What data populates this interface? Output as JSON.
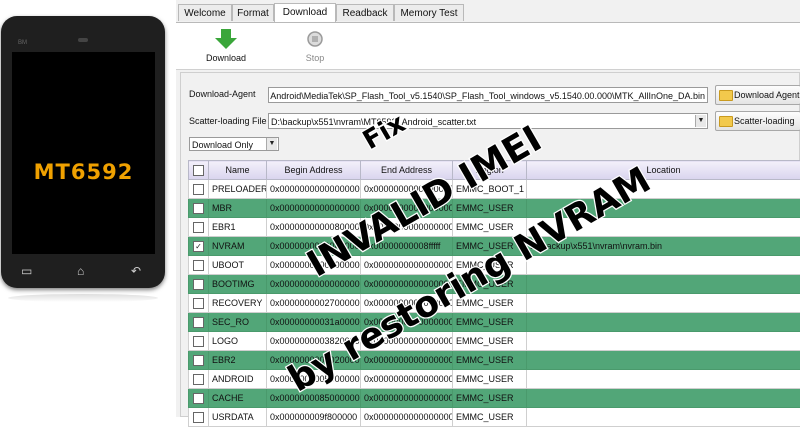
{
  "phone": {
    "brand": "BM",
    "model": "MT6592",
    "buttons": [
      "▭",
      "⌂",
      "↶"
    ]
  },
  "tabs": [
    {
      "label": "Welcome"
    },
    {
      "label": "Format"
    },
    {
      "label": "Download",
      "active": true
    },
    {
      "label": "Readback"
    },
    {
      "label": "Memory Test"
    }
  ],
  "toolbar": {
    "download_label": "Download",
    "stop_label": "Stop",
    "download_icon": "down-arrow-icon",
    "stop_icon": "stop-icon"
  },
  "form": {
    "da_label": "Download-Agent",
    "da_value": "Android\\MediaTek\\SP_Flash_Tool_v5.1540\\SP_Flash_Tool_windows_v5.1540.00.000\\MTK_AllInOne_DA.bin",
    "da_button": "Download Agent",
    "scatter_label": "Scatter-loading File",
    "scatter_value": "D:\\backup\\x551\\nvram\\MT6592_Android_scatter.txt",
    "scatter_button": "Scatter-loading",
    "mode_value": "Download Only"
  },
  "table": {
    "columns": [
      "",
      "Name",
      "Begin Address",
      "End Address",
      "Region",
      "Location"
    ],
    "rows": [
      {
        "checked": false,
        "name": "PRELOADER",
        "begin": "0x0000000000000000",
        "end": "0x0000000000000000",
        "region": "EMMC_BOOT_1",
        "location": ""
      },
      {
        "checked": false,
        "name": "MBR",
        "begin": "0x0000000000000000",
        "end": "0x0000000000000000",
        "region": "EMMC_USER",
        "location": ""
      },
      {
        "checked": false,
        "name": "EBR1",
        "begin": "0x0000000000080000",
        "end": "0x0000000000000000",
        "region": "EMMC_USER",
        "location": ""
      },
      {
        "checked": true,
        "name": "NVRAM",
        "begin": "0x0000000000040000",
        "end": "0x00000000008fffff",
        "region": "EMMC_USER",
        "location": "D:\\backup\\x551\\nvram\\nvram.bin"
      },
      {
        "checked": false,
        "name": "UBOOT",
        "begin": "0x0000000000000000",
        "end": "0x0000000000000000",
        "region": "EMMC_USER",
        "location": ""
      },
      {
        "checked": false,
        "name": "BOOTIMG",
        "begin": "0x0000000000000000",
        "end": "0x0000000000000000",
        "region": "EMMC_USER",
        "location": ""
      },
      {
        "checked": false,
        "name": "RECOVERY",
        "begin": "0x0000000002700000",
        "end": "0x0000000000000000",
        "region": "EMMC_USER",
        "location": ""
      },
      {
        "checked": false,
        "name": "SEC_RO",
        "begin": "0x00000000031a0000",
        "end": "0x0000000000000000",
        "region": "EMMC_USER",
        "location": ""
      },
      {
        "checked": false,
        "name": "LOGO",
        "begin": "0x0000000003820000",
        "end": "0x0000000000000000",
        "region": "EMMC_USER",
        "location": ""
      },
      {
        "checked": false,
        "name": "EBR2",
        "begin": "0x0000000004020000",
        "end": "0x0000000000000000",
        "region": "EMMC_USER",
        "location": ""
      },
      {
        "checked": false,
        "name": "ANDROID",
        "begin": "0x0000000005000000",
        "end": "0x0000000000000000",
        "region": "EMMC_USER",
        "location": ""
      },
      {
        "checked": false,
        "name": "CACHE",
        "begin": "0x0000000085000000",
        "end": "0x0000000000000000",
        "region": "EMMC_USER",
        "location": ""
      },
      {
        "checked": false,
        "name": "USRDATA",
        "begin": "0x000000009f800000",
        "end": "0x0000000000000000",
        "region": "EMMC_USER",
        "location": ""
      }
    ]
  },
  "overlay": {
    "line1": "Fix",
    "line2": "INVALID IMEI",
    "line3": "by restoring NVRAM"
  },
  "colors": {
    "row_highlight": "#52a678",
    "phone_model": "#f0a100",
    "download_icon": "#3aa63a"
  }
}
